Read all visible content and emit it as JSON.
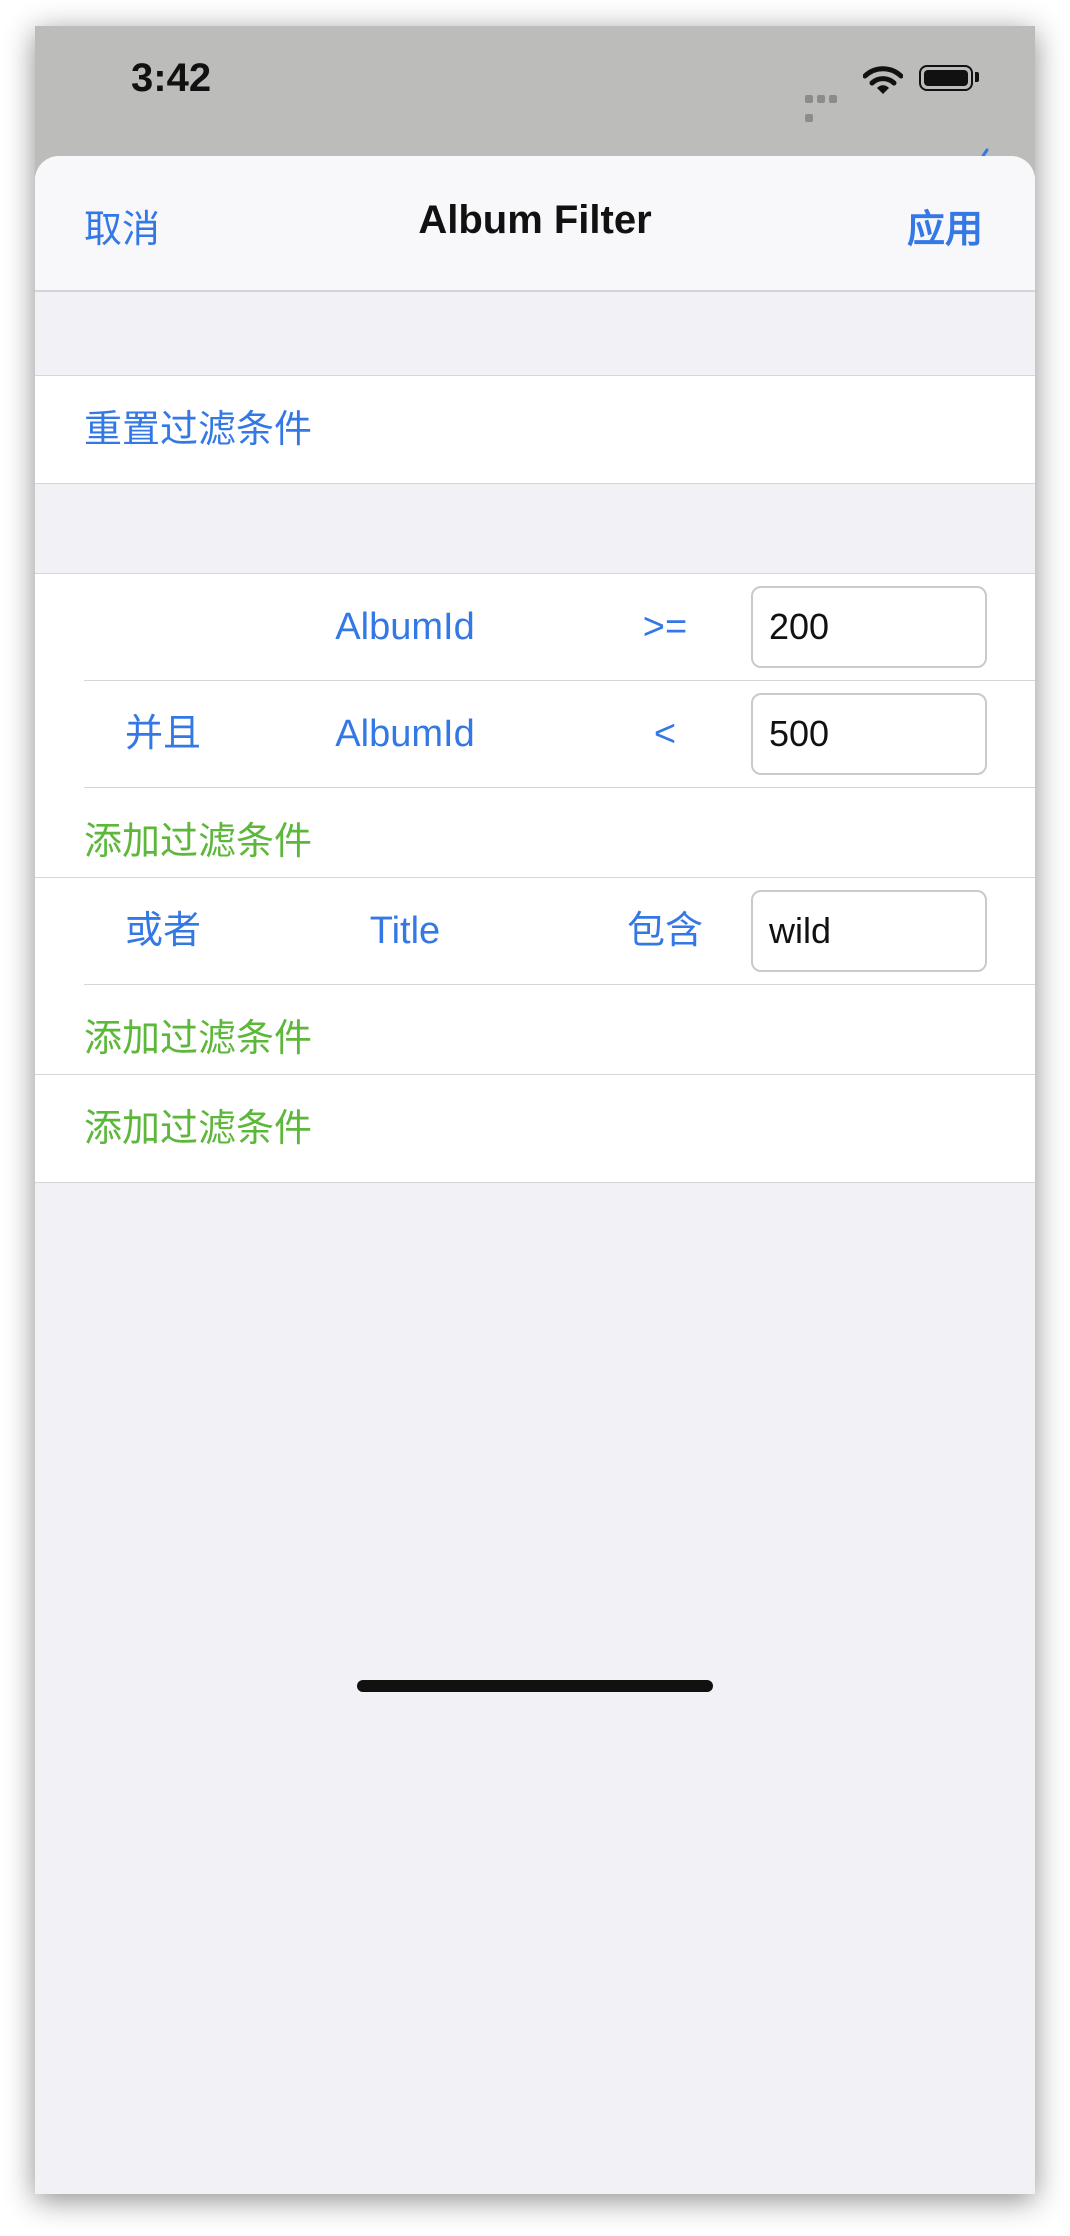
{
  "status_bar": {
    "time": "3:42"
  },
  "nav": {
    "cancel": "取消",
    "title": "Album Filter",
    "apply": "应用"
  },
  "reset": {
    "label": "重置过滤条件"
  },
  "group1": {
    "rows": [
      {
        "logic": "",
        "field": "AlbumId",
        "op": ">=",
        "value": "200"
      },
      {
        "logic": "并且",
        "field": "AlbumId",
        "op": "<",
        "value": "500"
      }
    ],
    "add_label": "添加过滤条件"
  },
  "group2": {
    "rows": [
      {
        "logic": "或者",
        "field": "Title",
        "op": "包含",
        "value": "wild"
      }
    ],
    "add_label": "添加过滤条件"
  },
  "group3": {
    "add_label": "添加过滤条件"
  },
  "colors": {
    "accent": "#3478e5",
    "add": "#5cb73a",
    "background": "#f1f1f6"
  },
  "icons": [
    "cellular-signal-icon",
    "wifi-icon",
    "battery-icon"
  ]
}
